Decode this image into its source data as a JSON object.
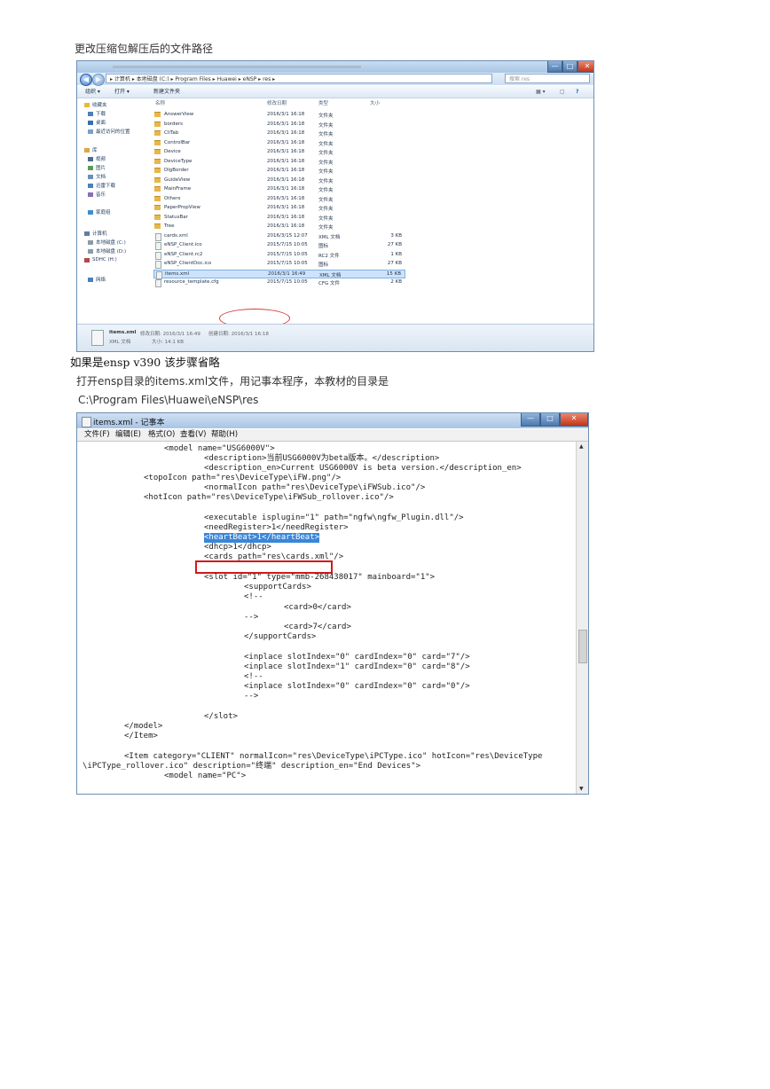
{
  "doc": {
    "heading1": "更改压缩包解压后的文件路径",
    "note_serif": "如果是ensp  v390 该步骤省略",
    "instruction": "打开ensp目录的items.xml文件，用记事本程序，本教材的目录是",
    "path": "C:\\Program Files\\Huawei\\eNSP\\res"
  },
  "explorer": {
    "window_buttons": [
      "—",
      "□",
      "✕"
    ],
    "address": "▸ 计算机 ▸ 本地磁盘 (C:) ▸ Program Files ▸ Huawei ▸ eNSP ▸ res ▸",
    "search_placeholder": "搜索 res",
    "toolbar": {
      "organize": "组织 ▾",
      "open": "打开 ▾",
      "new_folder": "新建文件夹"
    },
    "nav": [
      {
        "label": "收藏夹",
        "icon": "star-icon"
      },
      {
        "label": "下载",
        "icon": "download-icon"
      },
      {
        "label": "桌面",
        "icon": "desktop-icon"
      },
      {
        "label": "最近访问的位置",
        "icon": "recent-icon"
      },
      {
        "label": "库",
        "icon": "library-icon"
      },
      {
        "label": "视频",
        "icon": "video-icon"
      },
      {
        "label": "图片",
        "icon": "picture-icon"
      },
      {
        "label": "文档",
        "icon": "document-icon"
      },
      {
        "label": "迅雷下载",
        "icon": "download-icon"
      },
      {
        "label": "音乐",
        "icon": "music-icon"
      },
      {
        "label": "家庭组",
        "icon": "homegroup-icon"
      },
      {
        "label": "计算机",
        "icon": "computer-icon"
      },
      {
        "label": "本地磁盘 (C:)",
        "icon": "drive-icon"
      },
      {
        "label": "本地磁盘 (D:)",
        "icon": "drive-icon"
      },
      {
        "label": "SDHC (H:)",
        "icon": "sd-card-icon"
      },
      {
        "label": "网络",
        "icon": "network-icon"
      }
    ],
    "columns": {
      "name": "名称",
      "date": "修改日期",
      "type": "类型",
      "size": "大小"
    },
    "files": [
      {
        "name": "AnswerView",
        "date": "2016/3/1 16:18",
        "type": "文件夹",
        "size": "",
        "kind": "folder"
      },
      {
        "name": "borders",
        "date": "2016/3/1 16:18",
        "type": "文件夹",
        "size": "",
        "kind": "folder"
      },
      {
        "name": "CliTab",
        "date": "2016/3/1 16:18",
        "type": "文件夹",
        "size": "",
        "kind": "folder"
      },
      {
        "name": "ControlBar",
        "date": "2016/3/1 16:18",
        "type": "文件夹",
        "size": "",
        "kind": "folder"
      },
      {
        "name": "Device",
        "date": "2016/3/1 16:18",
        "type": "文件夹",
        "size": "",
        "kind": "folder"
      },
      {
        "name": "DeviceType",
        "date": "2016/3/1 16:18",
        "type": "文件夹",
        "size": "",
        "kind": "folder"
      },
      {
        "name": "DlgBorder",
        "date": "2016/3/1 16:18",
        "type": "文件夹",
        "size": "",
        "kind": "folder"
      },
      {
        "name": "GuideView",
        "date": "2016/3/1 16:18",
        "type": "文件夹",
        "size": "",
        "kind": "folder"
      },
      {
        "name": "MainFrame",
        "date": "2016/3/1 16:18",
        "type": "文件夹",
        "size": "",
        "kind": "folder"
      },
      {
        "name": "Others",
        "date": "2016/3/1 16:18",
        "type": "文件夹",
        "size": "",
        "kind": "folder"
      },
      {
        "name": "PaperPropView",
        "date": "2016/3/1 16:18",
        "type": "文件夹",
        "size": "",
        "kind": "folder"
      },
      {
        "name": "StatusBar",
        "date": "2016/3/1 16:18",
        "type": "文件夹",
        "size": "",
        "kind": "folder"
      },
      {
        "name": "Tree",
        "date": "2016/3/1 16:18",
        "type": "文件夹",
        "size": "",
        "kind": "folder"
      },
      {
        "name": "cards.xml",
        "date": "2016/3/15 12:07",
        "type": "XML 文档",
        "size": "3 KB",
        "kind": "file"
      },
      {
        "name": "eNSP_Client.ico",
        "date": "2015/7/15 10:05",
        "type": "图标",
        "size": "27 KB",
        "kind": "file"
      },
      {
        "name": "eNSP_Client.rc2",
        "date": "2015/7/15 10:05",
        "type": "RC2 文件",
        "size": "1 KB",
        "kind": "file"
      },
      {
        "name": "eNSP_ClientDoc.ico",
        "date": "2015/7/15 10:05",
        "type": "图标",
        "size": "27 KB",
        "kind": "file"
      },
      {
        "name": "items.xml",
        "date": "2016/3/1 16:49",
        "type": "XML 文档",
        "size": "15 KB",
        "kind": "file"
      },
      {
        "name": "resource_template.cfg",
        "date": "2015/7/15 10:05",
        "type": "CFG 文件",
        "size": "2 KB",
        "kind": "file"
      }
    ],
    "status": {
      "filename": "items.xml",
      "modified": "修改日期: 2016/3/1 16:49",
      "created": "创建日期: 2016/3/1 16:18",
      "type": "XML 文档",
      "size": "大小: 14.1 KB"
    }
  },
  "notepad": {
    "title": "items.xml - 记事本",
    "window_buttons": [
      "—",
      "□",
      "✕"
    ],
    "menu": [
      "文件(F)",
      "编辑(E)",
      "格式(O)",
      "查看(V)",
      "帮助(H)"
    ],
    "lines": [
      "<model name=\"USG6000V\">",
      "<description>当前USG6000V为beta版本。</description>",
      "<description_en>Current USG6000V is beta version.</description_en>",
      "<topoIcon path=\"res\\DeviceType\\iFW.png\"/>",
      "<normalIcon path=\"res\\DeviceType\\iFWSub.ico\"/>",
      "<hotIcon path=\"res\\DeviceType\\iFWSub_rollover.ico\"/>",
      "<executable isplugin=\"1\" path=\"ngfw\\ngfw_Plugin.dll\"/>",
      "<needRegister>1</needRegister>",
      "<heartBeat>1</heartBeat>",
      "<dhcp>1</dhcp>",
      "<cards path=\"res\\cards.xml\"/>",
      "<slot id=\"1\" type=\"mmb-268438017\" mainboard=\"1\">",
      "<supportCards>",
      "<!--",
      "<card>0</card>",
      "-->",
      "<card>7</card>",
      "</supportCards>",
      "<inplace slotIndex=\"0\" cardIndex=\"0\" card=\"7\"/>",
      "<inplace slotIndex=\"1\" cardIndex=\"0\" card=\"8\"/>",
      "<!--",
      "<inplace slotIndex=\"0\" cardIndex=\"0\" card=\"0\"/>",
      "-->",
      "</slot>",
      "</model>",
      "</Item>",
      "<Item category=\"CLIENT\" normalIcon=\"res\\DeviceType\\iPCType.ico\" hotIcon=\"res\\DeviceType",
      "\\iPCType_rollover.ico\" description=\"终端\" description_en=\"End Devices\">",
      "<model name=\"PC\">"
    ]
  }
}
